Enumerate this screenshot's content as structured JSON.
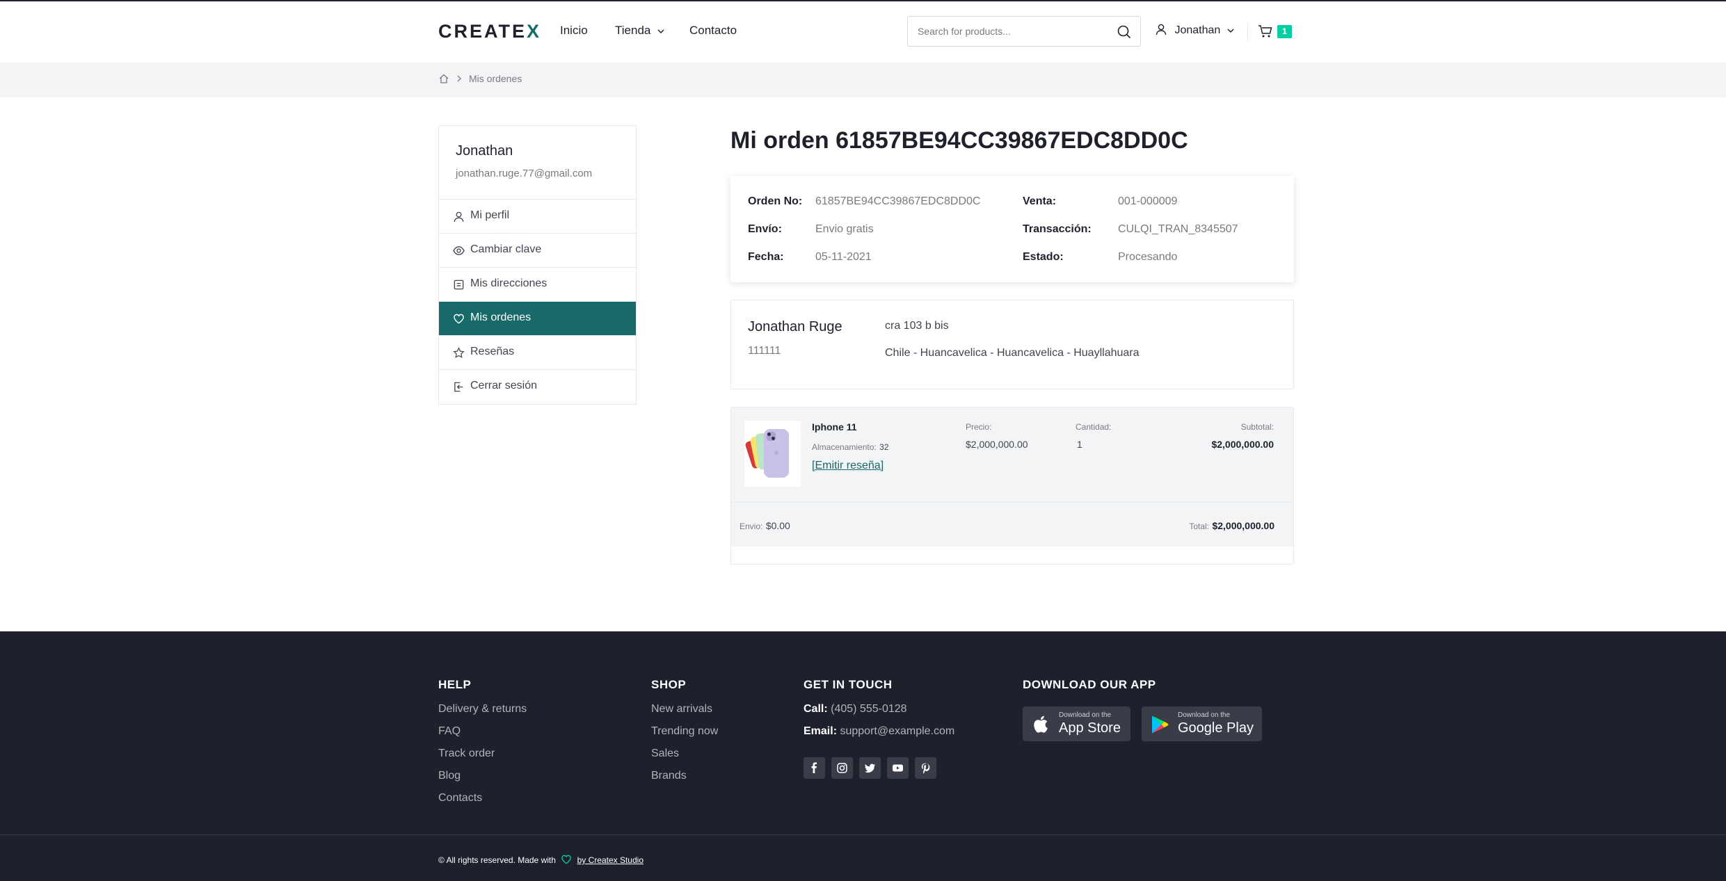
{
  "header": {
    "logo_main": "CREATE",
    "logo_x": "X",
    "nav": [
      "Inicio",
      "Tienda",
      "Contacto"
    ],
    "search_placeholder": "Search for products...",
    "user_name": "Jonathan",
    "cart_count": "1"
  },
  "breadcrumb": {
    "current": "Mis ordenes"
  },
  "sidebar": {
    "name": "Jonathan",
    "email": "jonathan.ruge.77@gmail.com",
    "items": [
      {
        "label": "Mi perfil",
        "icon": "user-icon"
      },
      {
        "label": "Cambiar clave",
        "icon": "eye-icon"
      },
      {
        "label": "Mis direcciones",
        "icon": "clipboard-icon"
      },
      {
        "label": "Mis ordenes",
        "icon": "heart-icon",
        "active": true
      },
      {
        "label": "Reseñas",
        "icon": "star-icon"
      },
      {
        "label": "Cerrar sesión",
        "icon": "logout-icon"
      }
    ]
  },
  "order": {
    "title": "Mi orden 61857BE94CC39867EDC8DD0C",
    "details": {
      "order_no_label": "Orden No:",
      "order_no": "61857BE94CC39867EDC8DD0C",
      "envio_label": "Envío:",
      "envio": "Envio gratis",
      "fecha_label": "Fecha:",
      "fecha": "05-11-2021",
      "venta_label": "Venta:",
      "venta": "001-000009",
      "transaccion_label": "Transacción:",
      "transaccion": "CULQI_TRAN_8345507",
      "estado_label": "Estado:",
      "estado": "Procesando"
    },
    "address": {
      "name": "Jonathan Ruge",
      "phone": "111111",
      "line1": "cra 103 b bis",
      "line2": "Chile - Huancavelica - Huancavelica - Huayllahuara"
    },
    "item": {
      "name": "Iphone 11",
      "storage_label": "Almacenamiento:",
      "storage": "32",
      "review_link": "[Emitir reseña]",
      "price_label": "Precio:",
      "price": "$2,000,000.00",
      "qty_label": "Cantidad:",
      "qty": "1",
      "subtotal_label": "Subtotal:",
      "subtotal": "$2,000,000.00"
    },
    "summary": {
      "shipping_label": "Envio:",
      "shipping": "$0.00",
      "total_label": "Total:",
      "total": "$2,000,000.00"
    }
  },
  "footer": {
    "help_title": "HELP",
    "help_links": [
      "Delivery & returns",
      "FAQ",
      "Track order",
      "Blog",
      "Contacts"
    ],
    "shop_title": "SHOP",
    "shop_links": [
      "New arrivals",
      "Trending now",
      "Sales",
      "Brands"
    ],
    "contact_title": "GET IN TOUCH",
    "call_label": "Call:",
    "call": "(405) 555-0128",
    "email_label": "Email:",
    "email": "support@example.com",
    "socials": [
      "facebook-icon",
      "instagram-icon",
      "twitter-icon",
      "youtube-icon",
      "pinterest-icon"
    ],
    "app_title": "DOWNLOAD OUR APP",
    "appstore_small": "Download on the",
    "appstore_big": "App Store",
    "googleplay_small": "Download on the",
    "googleplay_big": "Google Play",
    "copyright": "© All rights reserved. Made with",
    "credit": "by Createx Studio"
  },
  "colors": {
    "accent": "#17696a",
    "badge": "#03cea4",
    "footer_bg": "#1e212c"
  }
}
